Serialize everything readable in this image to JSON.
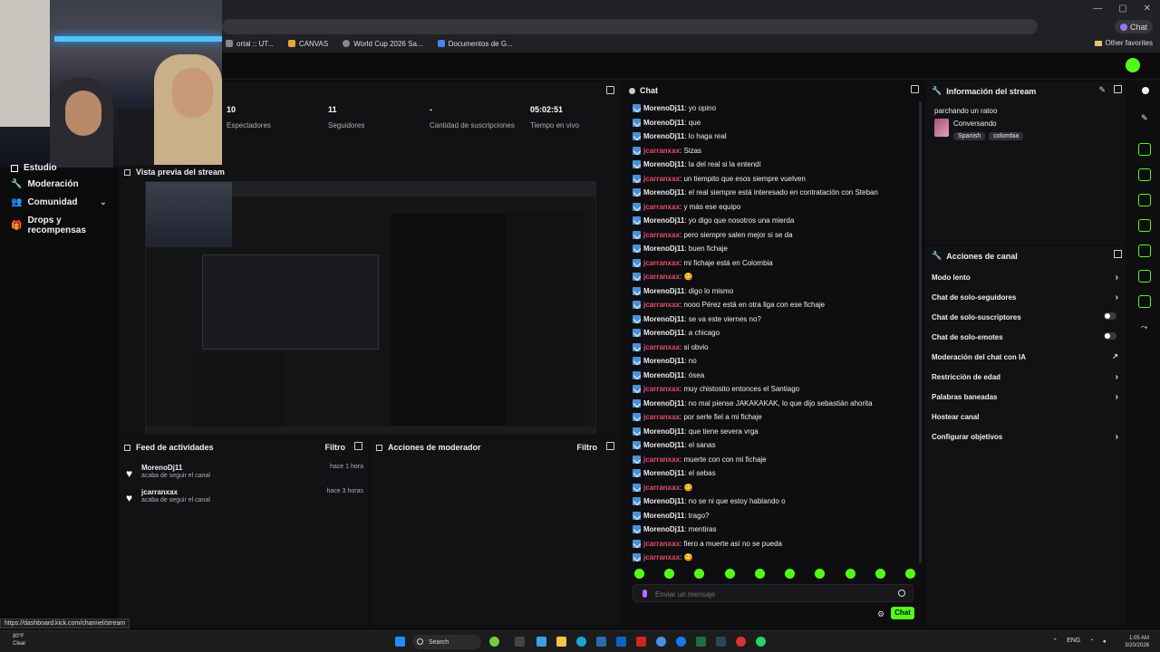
{
  "browser": {
    "bookmarks": [
      {
        "label": "ortal :: UT..."
      },
      {
        "label": "CANVAS"
      },
      {
        "label": "World Cup 2026 Sa..."
      },
      {
        "label": "Documentos de G..."
      }
    ],
    "other_favorites": "Other favorites",
    "chat_label": "Chat"
  },
  "sidebar": {
    "items": [
      {
        "label": "Estudio"
      },
      {
        "label": "Moderación"
      },
      {
        "label": "Comunidad"
      },
      {
        "label": "Drops y recompensas"
      }
    ]
  },
  "stats": [
    {
      "value": "10",
      "label": "Espectadores"
    },
    {
      "value": "11",
      "label": "Seguidores"
    },
    {
      "value": "-",
      "label": "Cantidad de suscripciones"
    },
    {
      "value": "05:02:51",
      "label": "Tiempo en vivo"
    }
  ],
  "preview": {
    "title": "Vista previa del stream"
  },
  "feed": {
    "title": "Feed de actividades",
    "filter": "Filtro",
    "items": [
      {
        "name": "MorenoDj11",
        "action": "acaba de seguir el canal",
        "time": "hace 1 hora"
      },
      {
        "name": "jcarranxax",
        "action": "acaba de seguir el canal",
        "time": "hace 3 horas"
      }
    ]
  },
  "moderator": {
    "title": "Acciones de moderador",
    "filter": "Filtro"
  },
  "chat": {
    "title": "Chat",
    "messages": [
      {
        "user": "MorenoDj11",
        "text": ": yo opino"
      },
      {
        "user": "MorenoDj11",
        "text": ": que"
      },
      {
        "user": "MorenoDj11",
        "text": ": lo haga real"
      },
      {
        "user": "jcarranxax",
        "text": ": Sizas"
      },
      {
        "user": "MorenoDj11",
        "text": ": la del real si la entendí"
      },
      {
        "user": "jcarranxax",
        "text": ": un tiempito que esos siempre vuelven"
      },
      {
        "user": "MorenoDj11",
        "text": ": el real siempre está interesado en contratación con Steban"
      },
      {
        "user": "jcarranxax",
        "text": ": y más ese equipo"
      },
      {
        "user": "MorenoDj11",
        "text": ": yo digo que nosotros una mierda"
      },
      {
        "user": "jcarranxax",
        "text": ": pero siempre salen mejor si se da"
      },
      {
        "user": "MorenoDj11",
        "text": ": buen fichaje"
      },
      {
        "user": "jcarranxax",
        "text": ": mi fichaje está en Colombia"
      },
      {
        "user": "jcarranxax",
        "text": ": 😋"
      },
      {
        "user": "MorenoDj11",
        "text": ": digo lo mismo"
      },
      {
        "user": "jcarranxax",
        "text": ": nooo Pérez está en otra liga con ese fichaje"
      },
      {
        "user": "MorenoDj11",
        "text": ": se va este viernes no?"
      },
      {
        "user": "MorenoDj11",
        "text": ": a chicago"
      },
      {
        "user": "jcarranxax",
        "text": ": si obvio"
      },
      {
        "user": "MorenoDj11",
        "text": ": no"
      },
      {
        "user": "MorenoDj11",
        "text": ": ósea"
      },
      {
        "user": "jcarranxax",
        "text": ": muy chistosito entonces el Santiago"
      },
      {
        "user": "MorenoDj11",
        "text": ": no mal piense JAKAKAKAK, lo que dijo sebastián ahorita"
      },
      {
        "user": "jcarranxax",
        "text": ": por serle fiel a mi fichaje"
      },
      {
        "user": "MorenoDj11",
        "text": ": que tiene severa vrga"
      },
      {
        "user": "MorenoDj11",
        "text": ": el sanas"
      },
      {
        "user": "jcarranxax",
        "text": ": muerte con con mi fichaje"
      },
      {
        "user": "MorenoDj11",
        "text": ": el sebas"
      },
      {
        "user": "jcarranxax",
        "text": ": 😋"
      },
      {
        "user": "MorenoDj11",
        "text": ": no se ni que estoy hablando o"
      },
      {
        "user": "MorenoDj11",
        "text": ": trago?"
      },
      {
        "user": "MorenoDj11",
        "text": ": mentiras"
      },
      {
        "user": "jcarranxax",
        "text": ": fiero a muerte así no se pueda"
      },
      {
        "user": "jcarranxax",
        "text": ": 😋"
      }
    ],
    "input_placeholder": "Enviar un mensaje",
    "send_label": "Chat"
  },
  "stream_info": {
    "title": "Información del stream",
    "stream_title": "parchando un ratoo",
    "category": "Conversando",
    "tags": [
      "Spanish",
      "colombia"
    ]
  },
  "channel_actions": {
    "title": "Acciones de canal",
    "items": [
      {
        "label": "Modo lento",
        "control": "arrow"
      },
      {
        "label": "Chat de solo-seguidores",
        "control": "arrow"
      },
      {
        "label": "Chat de solo-suscriptores",
        "control": "toggle"
      },
      {
        "label": "Chat de solo-emotes",
        "control": "toggle"
      },
      {
        "label": "Moderación del chat con IA",
        "control": "external"
      },
      {
        "label": "Restricción de edad",
        "control": "arrow"
      },
      {
        "label": "Palabras baneadas",
        "control": "arrow"
      },
      {
        "label": "Hostear canal",
        "control": "none"
      },
      {
        "label": "Configurar objetivos",
        "control": "arrow"
      }
    ]
  },
  "status_url": "https://dashboard.kick.com/channel/stream",
  "taskbar": {
    "search": "Search",
    "weather_temp": "80°F",
    "weather_desc": "Clear",
    "lang": "ENG",
    "time": "1:05 AM",
    "date": "3/20/2026"
  },
  "colors": {
    "accent": "#53fc18",
    "mod_name": "#e84d6b",
    "bg": "#0e0e10"
  }
}
